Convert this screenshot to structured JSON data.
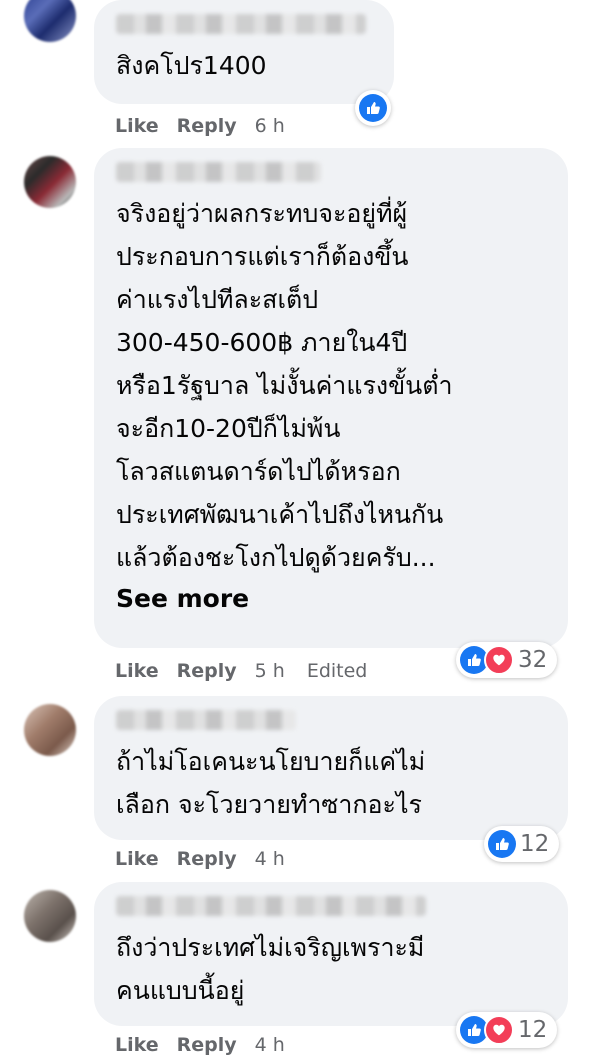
{
  "colors": {
    "like_blue": "#1877f2",
    "love_red": "#f33e58",
    "bubble_bg": "#f0f2f5",
    "meta_gray": "#65676b"
  },
  "comments": [
    {
      "text": "สิงคโปร1400",
      "actions": {
        "like": "Like",
        "reply": "Reply",
        "time": "6 h"
      },
      "reactions": {
        "icons": [
          "like-icon"
        ],
        "count": ""
      }
    },
    {
      "text": "จริงอยู่ว่าผลกระทบจะอยู่ที่ผู้\nประกอบการแต่เราก็ต้องขึ้น\nค่าแรงไปทีละสเต็ป\n300-450-600฿ ภายใน4ปี\nหรือ1รัฐบาล ไม่งั้นค่าแรงขั้นต่ำ\nจะอีก10-20ปีก็ไม่พ้น\nโลวสแตนดาร์ดไปได้หรอก\nประเทศพัฒนาเค้าไปถึงไหนกัน\nแล้วต้องชะโงกไปดูด้วยครับ...",
      "see_more": "See more",
      "actions": {
        "like": "Like",
        "reply": "Reply",
        "time": "5 h",
        "edited": "Edited"
      },
      "reactions": {
        "icons": [
          "like-icon",
          "love-icon"
        ],
        "count": "32"
      }
    },
    {
      "text": "ถ้าไม่โอเคนะนโยบายก็แค่ไม่\nเลือก จะโวยวายทำซากอะไร",
      "actions": {
        "like": "Like",
        "reply": "Reply",
        "time": "4 h"
      },
      "reactions": {
        "icons": [
          "like-icon"
        ],
        "count": "12"
      }
    },
    {
      "text": "ถึงว่าประเทศไม่เจริญเพราะมี\nคนแบบนี้อยู่",
      "actions": {
        "like": "Like",
        "reply": "Reply",
        "time": "4 h"
      },
      "reactions": {
        "icons": [
          "like-icon",
          "love-icon"
        ],
        "count": "12"
      }
    }
  ]
}
